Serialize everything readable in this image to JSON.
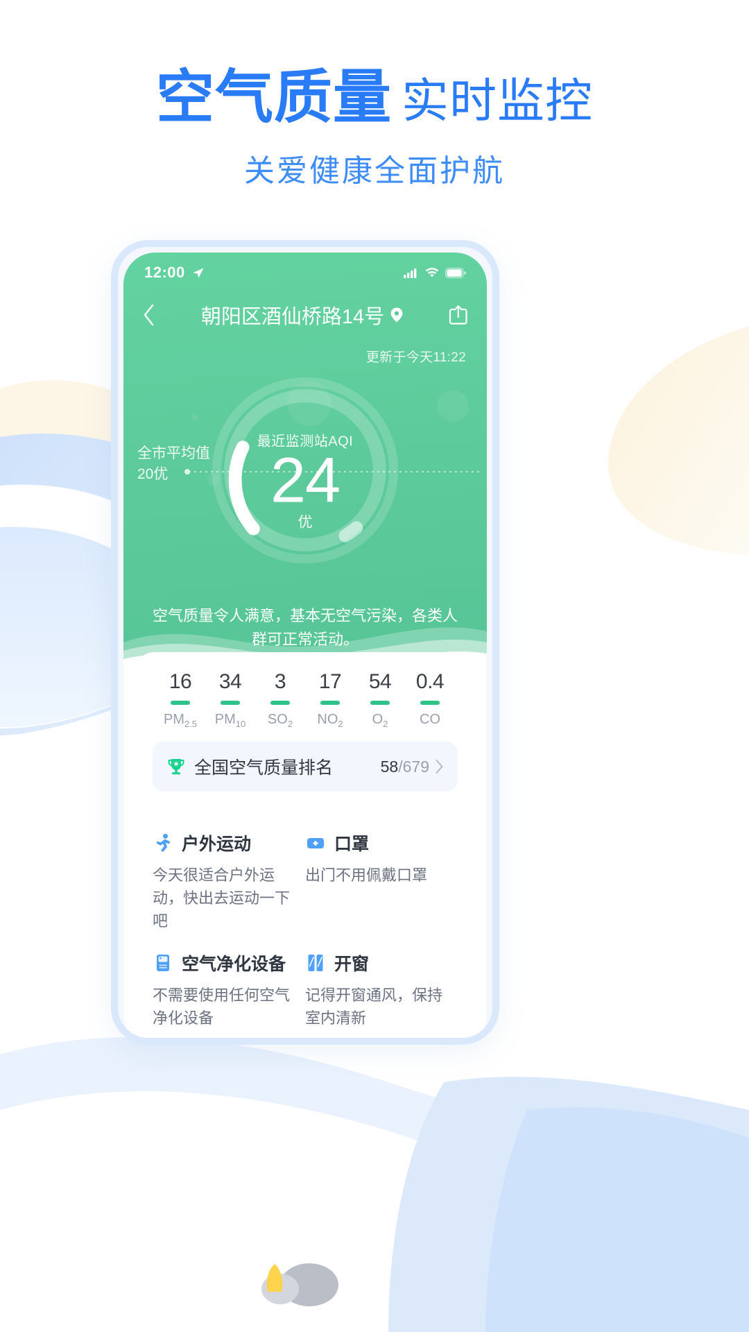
{
  "promo": {
    "title_strong": "空气质量",
    "title_light": "实时监控",
    "subtitle": "关爱健康全面护航",
    "title_color": "#2a7bf6"
  },
  "statusbar": {
    "time": "12:00",
    "location_icon": "location-arrow-icon",
    "signal_icon": "cellular-signal-icon",
    "wifi_icon": "wifi-icon",
    "battery_icon": "battery-icon"
  },
  "navbar": {
    "back_icon": "chevron-left-icon",
    "title": "朝阳区酒仙桥路14号",
    "pin_icon": "location-pin-icon",
    "share_icon": "share-icon"
  },
  "hero": {
    "updated": "更新于今天11:22",
    "gauge_label": "最近监测站AQI",
    "gauge_value": "24",
    "gauge_level": "优",
    "avg_line1": "全市平均值",
    "avg_line2": "20优",
    "description": "空气质量令人满意，基本无空气污染，各类人群可正常活动。",
    "accent": "#5ecb9c"
  },
  "pollutants": [
    {
      "value": "16",
      "name": "PM",
      "sub": "2.5"
    },
    {
      "value": "34",
      "name": "PM",
      "sub": "10"
    },
    {
      "value": "3",
      "name": "SO",
      "sub": "2"
    },
    {
      "value": "17",
      "name": "NO",
      "sub": "2"
    },
    {
      "value": "54",
      "name": "O",
      "sub": "2"
    },
    {
      "value": "0.4",
      "name": "CO",
      "sub": ""
    }
  ],
  "ranking": {
    "icon": "trophy-icon",
    "label": "全国空气质量排名",
    "rank": "58",
    "total": "/679",
    "chevron": "chevron-right-icon"
  },
  "advice": [
    {
      "icon": "running-person-icon",
      "title": "户外运动",
      "text": "今天很适合户外运动，快出去运动一下吧"
    },
    {
      "icon": "mask-icon",
      "title": "口罩",
      "text": "出门不用佩戴口罩"
    },
    {
      "icon": "air-purifier-icon",
      "title": "空气净化设备",
      "text": "不需要使用任何空气净化设备"
    },
    {
      "icon": "open-window-icon",
      "title": "开窗",
      "text": "记得开窗通风，保持室内清新"
    }
  ]
}
